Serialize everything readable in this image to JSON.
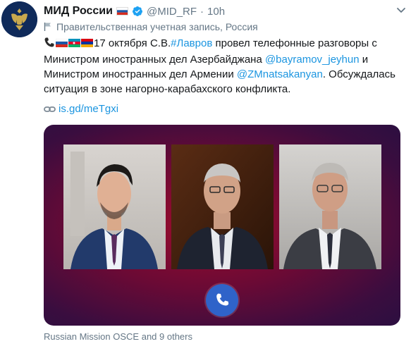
{
  "tweet": {
    "author_name": "МИД России",
    "handle": "@MID_RF",
    "separator": "·",
    "time": "10h",
    "gov_label": "Правительственная учетная запись, Россия",
    "text_date": "17 октября С.В.",
    "hashtag": "#Лавров",
    "text_part1": " провел телефонные разговоры с Министром иностранных дел Азербайджана ",
    "mention1": "@bayramov_jeyhun",
    "text_part2": " и Министром иностранных дел Армении ",
    "mention2": "@ZMnatsakanyan",
    "text_part3": ". Обсуждалась ситуация в зоне нагорно-карабахского конфликта.",
    "short_link": "is.gd/meTgxi",
    "footer": "Russian Mission OSCE and 9 others"
  },
  "icons": {
    "verified": "verified-badge-icon",
    "phone": "phone-icon",
    "link": "link-icon",
    "chevron": "chevron-down-icon",
    "gov": "flag-outline-icon"
  },
  "colors": {
    "link": "#1b95e0",
    "secondary_text": "#657786",
    "verified": "#1da1f2",
    "media_bg": "#6a0a35",
    "call_button": "#2f63c9"
  }
}
